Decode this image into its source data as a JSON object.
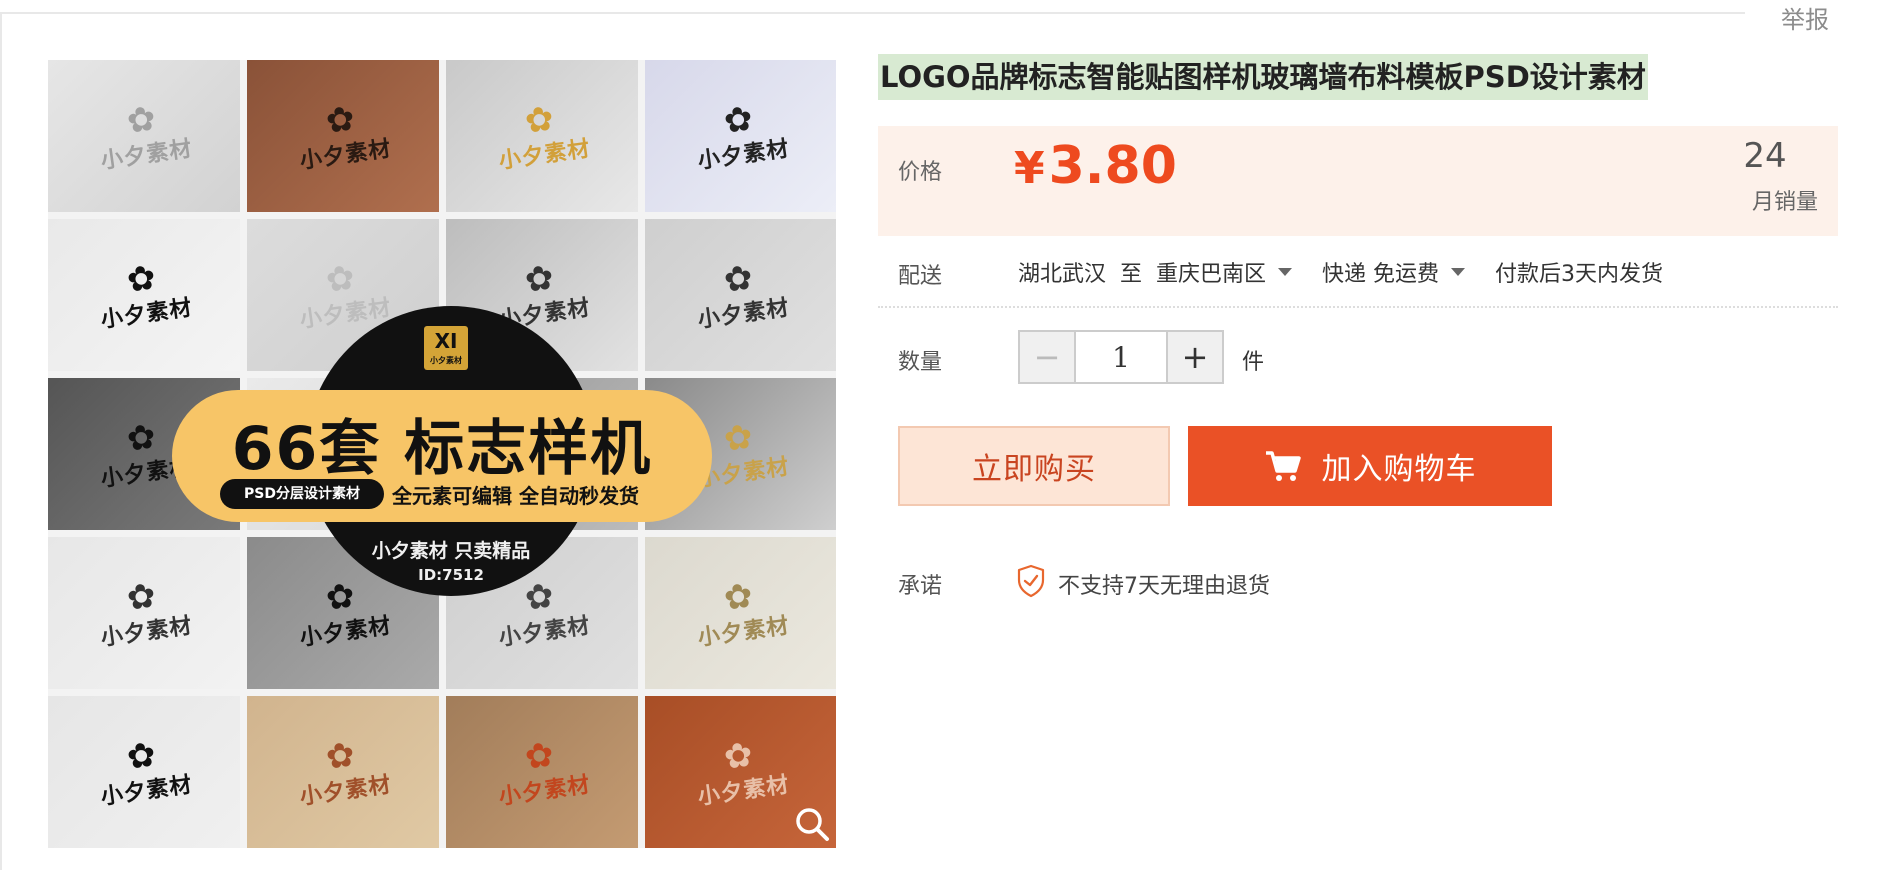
{
  "header": {
    "report_link": "举报"
  },
  "product": {
    "title": "LOGO品牌标志智能贴图样机玻璃墙布料模板PSD设计素材",
    "image": {
      "tile_mark": "小夕素材",
      "badge": "XI",
      "badge_sub": "小夕素材",
      "headline": "66套 标志样机",
      "tag": "PSD分层设计素材",
      "features": "全元素可编辑 全自动秒发货",
      "footer": "小夕素材 只卖精品",
      "id_text": "ID:7512",
      "zoom_icon": "magnifier-icon"
    }
  },
  "price": {
    "label": "价格",
    "currency": "¥",
    "value": "3.80",
    "sales_count": "24",
    "sales_label": "月销量",
    "accent_color": "#ee4a1f",
    "bg_color": "#fdf1ea"
  },
  "shipping": {
    "label": "配送",
    "from": "湖北武汉",
    "to_word": "至",
    "destination": "重庆巴南区",
    "method": "快递 免运费",
    "delivery": "付款后3天内发货"
  },
  "quantity": {
    "label": "数量",
    "minus": "−",
    "value": "1",
    "plus": "+",
    "unit": "件"
  },
  "actions": {
    "buy_now": "立即购买",
    "add_to_cart": "加入购物车",
    "cart_icon": "shopping-cart-icon"
  },
  "promise": {
    "label": "承诺",
    "icon": "shield-check-icon",
    "text": "不支持7天无理由退货"
  }
}
